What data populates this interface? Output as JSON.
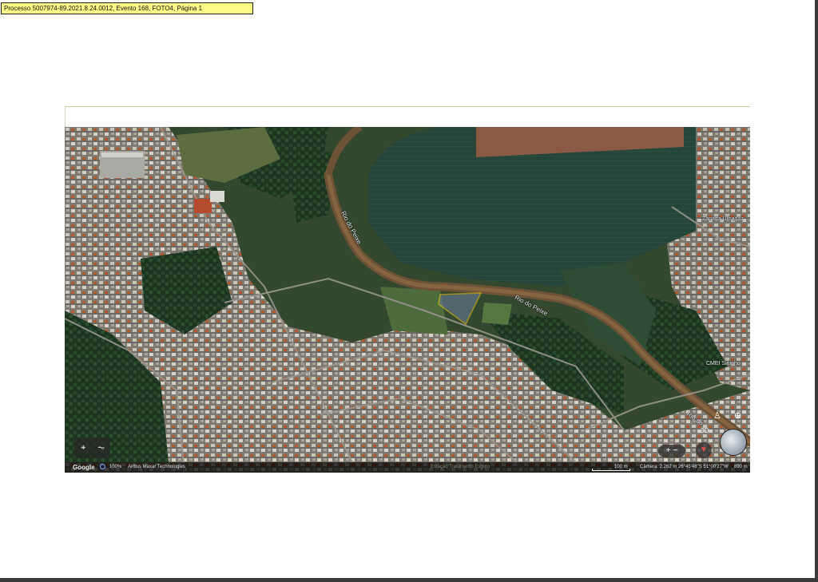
{
  "document": {
    "header_stamp": "Processo 5007974-89.2021.8.24.0012, Evento 168, FOTO4, Página 1"
  },
  "map": {
    "labels": {
      "river_1": "Rio do Peixe",
      "river_2": "Rio do Peixe",
      "river_3": "Rio do",
      "poi_zanatta": "Zanatta Ultragaz",
      "poi_cmei": "CMEI Sininho"
    },
    "controls": {
      "location_icon": "location-pin-icon",
      "terrain_icon": "terrain-icon",
      "street_view_icon": "pegman-icon",
      "locate_icon": "crosshair-icon",
      "view_3d": "3D",
      "compass_icon": "globe-compass-icon",
      "zoom_label": "+ −"
    },
    "statusbar": {
      "logo": "Google",
      "zoom_percent": "100%",
      "imagery_credit": "Airbus  Maxar Technologies",
      "bottom_text": "Estação Tratamento Esgoto",
      "scale": "100 m",
      "camera": "Câmera: 2.262 m",
      "coordinates": "26°45'48\"S 51°00'27\"W",
      "elevation": "890 m"
    },
    "colors": {
      "highlight_polygon": "#f2c81a",
      "river": "#7a5a3a",
      "crop_field": "#2a4a3a",
      "bare_soil": "#8a5a44",
      "forest": "#1f3a22",
      "urban": "#8f8a80"
    }
  }
}
